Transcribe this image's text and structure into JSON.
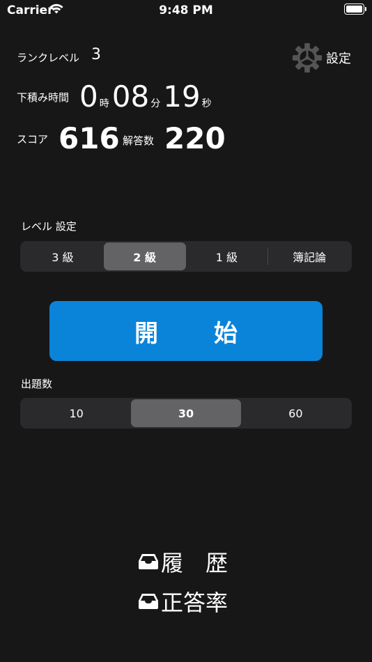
{
  "status_bar": {
    "carrier": "Carrier",
    "time": "9:48 PM"
  },
  "stats": {
    "rank_label": "ランクレベル",
    "rank_value": "3",
    "time_label": "下積み時間",
    "hours": "0",
    "hours_unit": "時",
    "minutes": "08",
    "minutes_unit": "分",
    "seconds": "19",
    "seconds_unit": "秒",
    "score_label": "スコア",
    "score_value": "616",
    "answers_label": "解答数",
    "answers_value": "220"
  },
  "settings": {
    "label": "設定",
    "icon": "gear-icon"
  },
  "level": {
    "section_label": "レベル 設定",
    "options": [
      "3 級",
      "2 級",
      "1 級",
      "簿記論"
    ],
    "selected": "2 級"
  },
  "start_button": {
    "char1": "開",
    "char2": "始",
    "bg_color": "#0a84d9"
  },
  "question_count": {
    "section_label": "出題数",
    "options": [
      "10",
      "30",
      "60"
    ],
    "selected": "30"
  },
  "links": {
    "history": "履　歴",
    "accuracy": "正答率",
    "icon": "tray-icon"
  }
}
